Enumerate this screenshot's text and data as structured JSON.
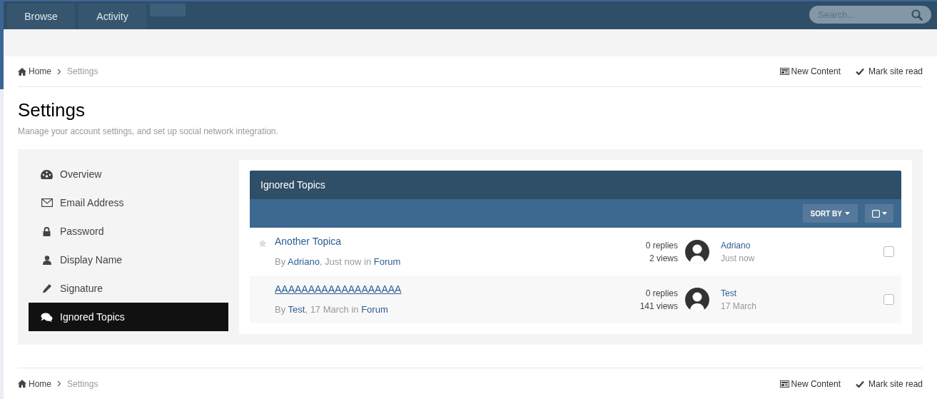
{
  "nav": {
    "tabs": [
      {
        "label": "Browse",
        "selected": false
      },
      {
        "label": "Activity",
        "selected": false
      }
    ],
    "search": {
      "placeholder": "Search..."
    }
  },
  "breadcrumb_top": {
    "items": [
      "Home",
      "Settings"
    ],
    "actions": [
      {
        "kind": "new",
        "label": "New Content"
      },
      {
        "kind": "read",
        "label": "Mark site read"
      }
    ]
  },
  "page": {
    "title": "Settings",
    "subtitle": "Manage your account settings, and set up social network integration."
  },
  "sidebar": {
    "items": [
      {
        "label": "Overview",
        "selected": false
      },
      {
        "label": "Email Address",
        "selected": false
      },
      {
        "label": "Password",
        "selected": false
      },
      {
        "label": "Display Name",
        "selected": false
      },
      {
        "label": "Signature",
        "selected": false
      },
      {
        "label": "Ignored Topics",
        "selected": true
      }
    ]
  },
  "panel": {
    "title": "Ignored Topics",
    "sort_label": "SORT BY",
    "rows": [
      {
        "title": "Another Topica",
        "underlined": false,
        "star": true,
        "by": "By",
        "author": "Adriano",
        "when": ", Just now in",
        "forum": "Forum",
        "replies": "0 replies",
        "views": "2 views",
        "last_user": "Adriano",
        "last_time": "Just now",
        "checked": false
      },
      {
        "title": "AAAAAAAAAAAAAAAAAAA",
        "underlined": true,
        "star": false,
        "by": "By",
        "author": "Test",
        "when": ", 17 March in",
        "forum": "Forum",
        "replies": "0 replies",
        "views": "141 views",
        "last_user": "Test",
        "last_time": "17 March",
        "checked": false
      }
    ]
  },
  "breadcrumb_bottom": {
    "items": [
      "Home",
      "Settings"
    ],
    "actions": [
      {
        "kind": "new",
        "label": "New Content"
      },
      {
        "kind": "read",
        "label": "Mark site read"
      }
    ]
  }
}
